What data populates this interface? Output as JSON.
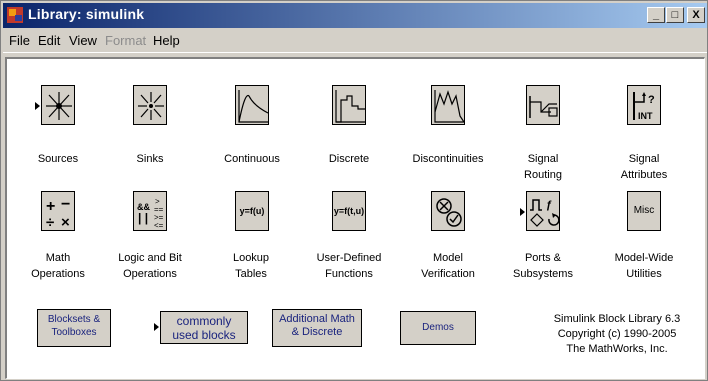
{
  "window": {
    "title": "Library: simulink"
  },
  "window_buttons": {
    "minimize": "_",
    "maximize": "□",
    "close": "X"
  },
  "menu": [
    "File",
    "Edit",
    "View",
    "Format",
    "Help"
  ],
  "blocks_row1": [
    {
      "label": "Sources",
      "icon": "sources-icon"
    },
    {
      "label": "Sinks",
      "icon": "sinks-icon"
    },
    {
      "label": "Continuous",
      "icon": "continuous-icon"
    },
    {
      "label": "Discrete",
      "icon": "discrete-icon"
    },
    {
      "label": "Discontinuities",
      "icon": "discontinuities-icon"
    },
    {
      "label": "Signal\nRouting",
      "icon": "signal-routing-icon"
    },
    {
      "label": "Signal\nAttributes",
      "icon": "signal-attributes-icon"
    }
  ],
  "blocks_row2": [
    {
      "label": "Math\nOperations",
      "icon": "math-icon"
    },
    {
      "label": "Logic and Bit\nOperations",
      "icon": "logic-icon"
    },
    {
      "label": "Lookup\nTables",
      "icon_text": "y=f(u)"
    },
    {
      "label": "User-Defined\nFunctions",
      "icon_text": "y=f(t,u)"
    },
    {
      "label": "Model\nVerification",
      "icon": "model-verification-icon"
    },
    {
      "label": "Ports &\nSubsystems",
      "icon": "ports-icon"
    },
    {
      "label": "Model-Wide\nUtilities",
      "icon_text": "Misc"
    }
  ],
  "blocks_row3": [
    {
      "label": "Blocksets &\nToolboxes"
    },
    {
      "label": "commonly\nused blocks"
    },
    {
      "label": "Additional Math\n& Discrete"
    },
    {
      "label": "Demos"
    }
  ],
  "copyright": [
    "Simulink Block Library 6.3",
    "Copyright (c) 1990-2005",
    "The MathWorks, Inc."
  ],
  "colors": {
    "titlebar_start": "#0a246a",
    "titlebar_end": "#a6caf0",
    "block_bg": "#d4d0c8"
  }
}
